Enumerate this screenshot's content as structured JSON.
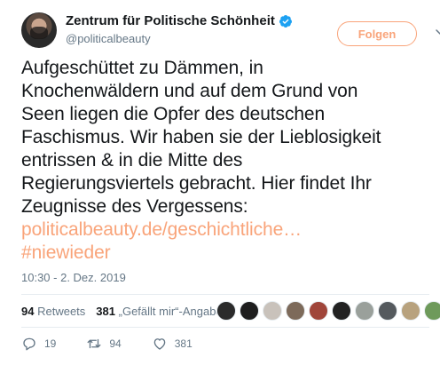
{
  "header": {
    "display_name": "Zentrum für Politische Schönheit",
    "handle": "@politicalbeauty",
    "follow_label": "Folgen"
  },
  "tweet": {
    "lines": [
      "Aufgeschüttet zu Dämmen, in",
      "Knochenwäldern und auf dem Grund von",
      "Seen liegen die Opfer des deutschen",
      "Faschismus. Wir haben sie der Lieblosigkeit",
      "entrissen & in die Mitte des",
      "Regierungsviertels gebracht. Hier findet Ihr",
      "Zeugnisse des Vergessens:"
    ],
    "link": "politicalbeauty.de/geschichtliche…",
    "hashtag": "#niewieder",
    "timestamp": "10:30 - 2. Dez. 2019"
  },
  "stats": {
    "retweets_count": "94",
    "retweets_label": "Retweets",
    "likes_count": "381",
    "likes_label": "„Gefällt mir“-Angaben"
  },
  "actions": {
    "replies": "19",
    "retweets": "94",
    "likes": "381"
  },
  "colors": {
    "accent": "#f9a47a",
    "text": "#14171a",
    "muted": "#657786",
    "verified": "#1da1f2"
  },
  "likers": [
    {
      "name": "liker-avatar",
      "color": "#2b2b2b"
    },
    {
      "name": "liker-avatar",
      "color": "#1e1e1e"
    },
    {
      "name": "liker-avatar",
      "color": "#c9c2bb"
    },
    {
      "name": "liker-avatar",
      "color": "#7d6a5a"
    },
    {
      "name": "liker-avatar",
      "color": "#a0453a"
    },
    {
      "name": "liker-avatar",
      "color": "#222222"
    },
    {
      "name": "liker-avatar",
      "color": "#9aa09b"
    },
    {
      "name": "liker-avatar",
      "color": "#555a5e"
    },
    {
      "name": "liker-avatar",
      "color": "#b8a27e"
    },
    {
      "name": "liker-avatar",
      "color": "#6e9a5b"
    }
  ]
}
